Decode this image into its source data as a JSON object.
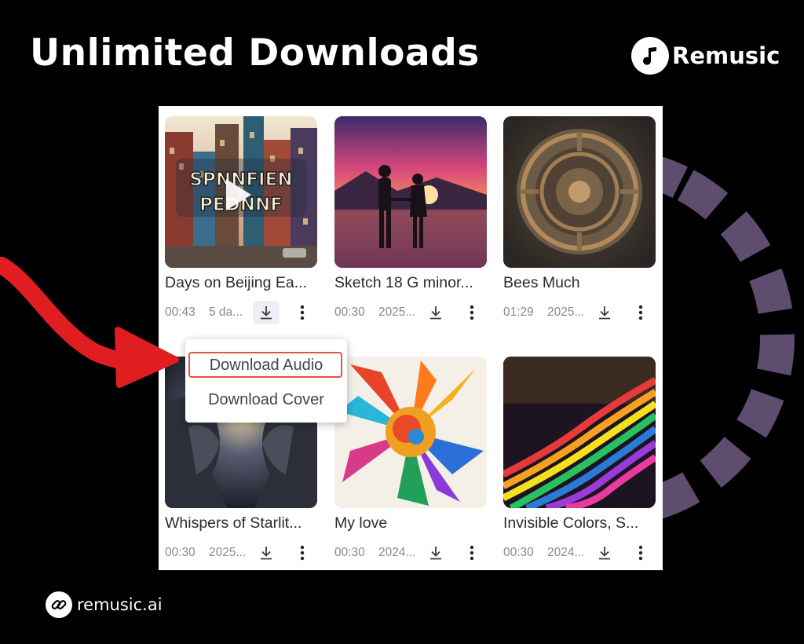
{
  "header": {
    "title": "Unlimited Downloads"
  },
  "brand": {
    "name": "Remusic",
    "icon": "music-note-icon"
  },
  "footer": {
    "site": "remusic.ai",
    "icon": "link-icon"
  },
  "colors": {
    "accent_dash": "#5e4d6e",
    "arrow": "#e01e22",
    "highlight": "#e5533a"
  },
  "songs": [
    {
      "title": "Days on Beijing Ea...",
      "duration": "00:43",
      "date": "5 da...",
      "playing": true
    },
    {
      "title": "Sketch 18 G minor...",
      "duration": "00:30",
      "date": "2025..."
    },
    {
      "title": "Bees Much",
      "duration": "01:29",
      "date": "2025..."
    },
    {
      "title": "Whispers of Starlit...",
      "duration": "00:30",
      "date": "2025..."
    },
    {
      "title": "My love",
      "duration": "00:30",
      "date": "2024..."
    },
    {
      "title": "Invisible Colors, S...",
      "duration": "00:30",
      "date": "2024..."
    }
  ],
  "menu": {
    "download_audio": "Download Audio",
    "download_cover": "Download Cover"
  },
  "thumbnail_text": "SPNNFIEN PEDNNF"
}
